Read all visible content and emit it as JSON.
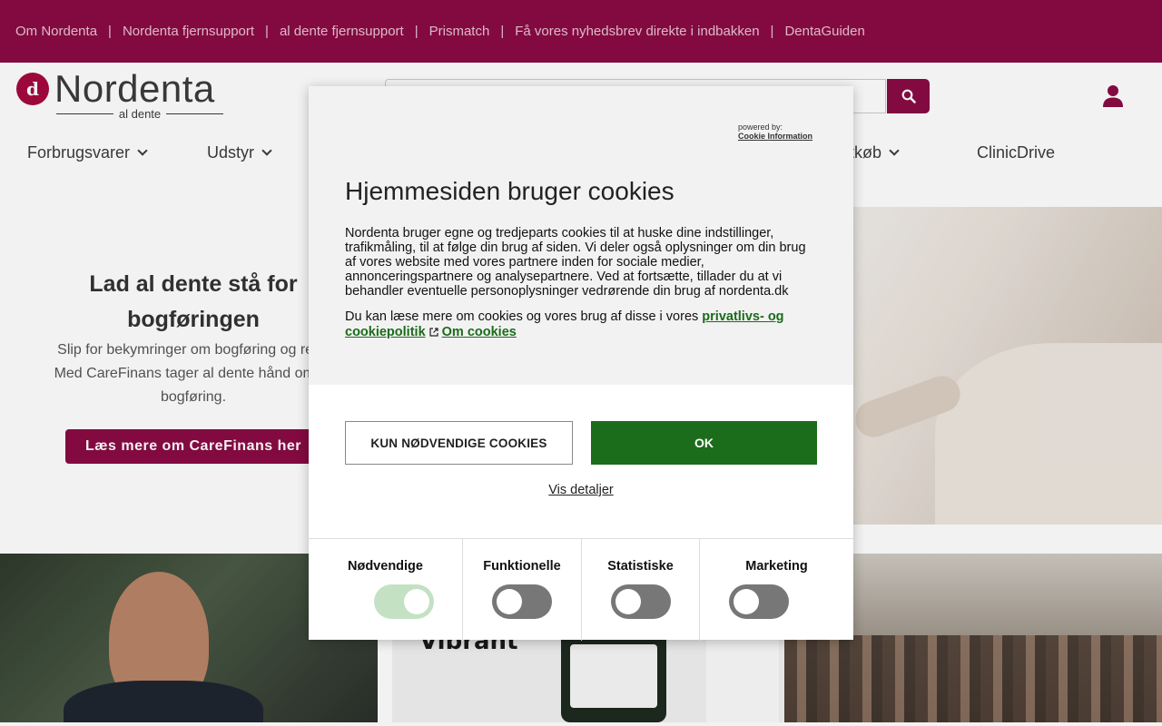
{
  "topbar": {
    "links": [
      "Om Nordenta",
      "Nordenta fjernsupport",
      "al dente fjernsupport",
      "Prismatch",
      "Få vores nyhedsbrev direkte i indbakken",
      "DentaGuiden"
    ],
    "separator": "|"
  },
  "header": {
    "logo_text": "Nordenta",
    "logo_sub": "al dente",
    "search_placeholder": ""
  },
  "nav": {
    "items": [
      "Forbrugsvarer",
      "Udstyr",
      "itkøb",
      "ClinicDrive"
    ]
  },
  "hero": {
    "title": "Lad al dente stå for bogføringen",
    "text": "Slip for bekymringer om bogføring og regn... Med CareFinans tager al dente hånd om kli... bogføring.",
    "text_line1": "Slip for bekymringer om bogføring og regn",
    "text_line2": "Med CareFinans tager al dente hånd om kli",
    "text_line3": "bogføring.",
    "button": "Læs mere om CareFinans her"
  },
  "tiles": {
    "tile2_brand": "Vibrant"
  },
  "cookie_dialog": {
    "powered_by": "powered by:",
    "powered_brand": "Cookie Information",
    "title": "Hjemmesiden bruger cookies",
    "text": "Nordenta bruger egne og tredjeparts cookies til at huske dine indstillinger, trafikmåling, til at følge din brug af siden. Vi deler også oplysninger om din brug af vores website med vores partnere inden for sociale medier, annonceringspartnere og analysepartnere. Ved at fortsætte, tillader du at vi behandler eventuelle personoplysninger vedrørende din brug af nordenta.dk",
    "text2_prefix": "Du kan læse mere om cookies og vores brug af disse i vores ",
    "privacy_link": "privatlivs- og cookiepolitik",
    "about_link": "Om cookies",
    "btn_necessary": "KUN NØDVENDIGE COOKIES",
    "btn_ok": "OK",
    "details": "Vis detaljer",
    "categories": [
      {
        "label": "Nødvendige",
        "enabled": true
      },
      {
        "label": "Funktionelle",
        "enabled": false
      },
      {
        "label": "Statistiske",
        "enabled": false
      },
      {
        "label": "Marketing",
        "enabled": false
      }
    ]
  },
  "colors": {
    "brand": "#8a0b44",
    "ok_green": "#1b6d1b",
    "toggle_on": "#c4e1c4",
    "toggle_off": "#777777"
  }
}
